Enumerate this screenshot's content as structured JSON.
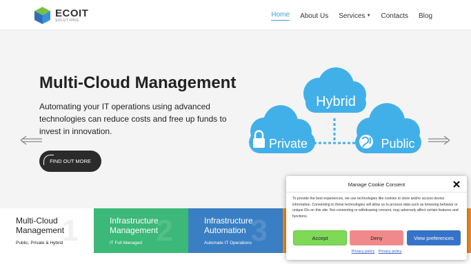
{
  "header": {
    "logo_name": "ECOIT",
    "logo_sub": "SOLUTIONS",
    "nav": [
      {
        "label": "Home",
        "active": true
      },
      {
        "label": "About Us"
      },
      {
        "label": "Services",
        "has_dropdown": true
      },
      {
        "label": "Contacts"
      },
      {
        "label": "Blog"
      }
    ]
  },
  "hero": {
    "title": "Multi-Cloud Management",
    "text": "Automating your IT operations using advanced technologies can reduce costs and free up funds to invest in innovation.",
    "cta_label": "FIND OUT MORE",
    "illustration": {
      "hybrid": "Hybrid",
      "private": "Private",
      "public": "Public"
    },
    "colors": {
      "cloud": "#42b0e8",
      "dots": "#42b0e8"
    }
  },
  "tiles": [
    {
      "title": "Multi-Cloud Management",
      "sub": "Public, Private & Hybrid",
      "num": "1",
      "color": "#ffffff"
    },
    {
      "title": "Infrastructure Management",
      "sub": "IT Full Managed",
      "num": "2",
      "color": "#3cb878"
    },
    {
      "title": "Infrastructure Automation",
      "sub": "Automate IT Operations",
      "num": "3",
      "color": "#3a7fc4"
    },
    {
      "title": "",
      "sub": "",
      "num": "",
      "color": "#f08a24"
    }
  ],
  "consent": {
    "title": "Manage Cookie Consent",
    "body": "To provide the best experiences, we use technologies like cookies to store and/or access device information. Consenting to these technologies will allow us to process data such as browsing behavior or unique IDs on this site. Not consenting or withdrawing consent, may adversely affect certain features and functions.",
    "accept": "Accept",
    "deny": "Deny",
    "preferences": "View preferences",
    "links": [
      "Privacy policy",
      "Privacy policy"
    ]
  }
}
